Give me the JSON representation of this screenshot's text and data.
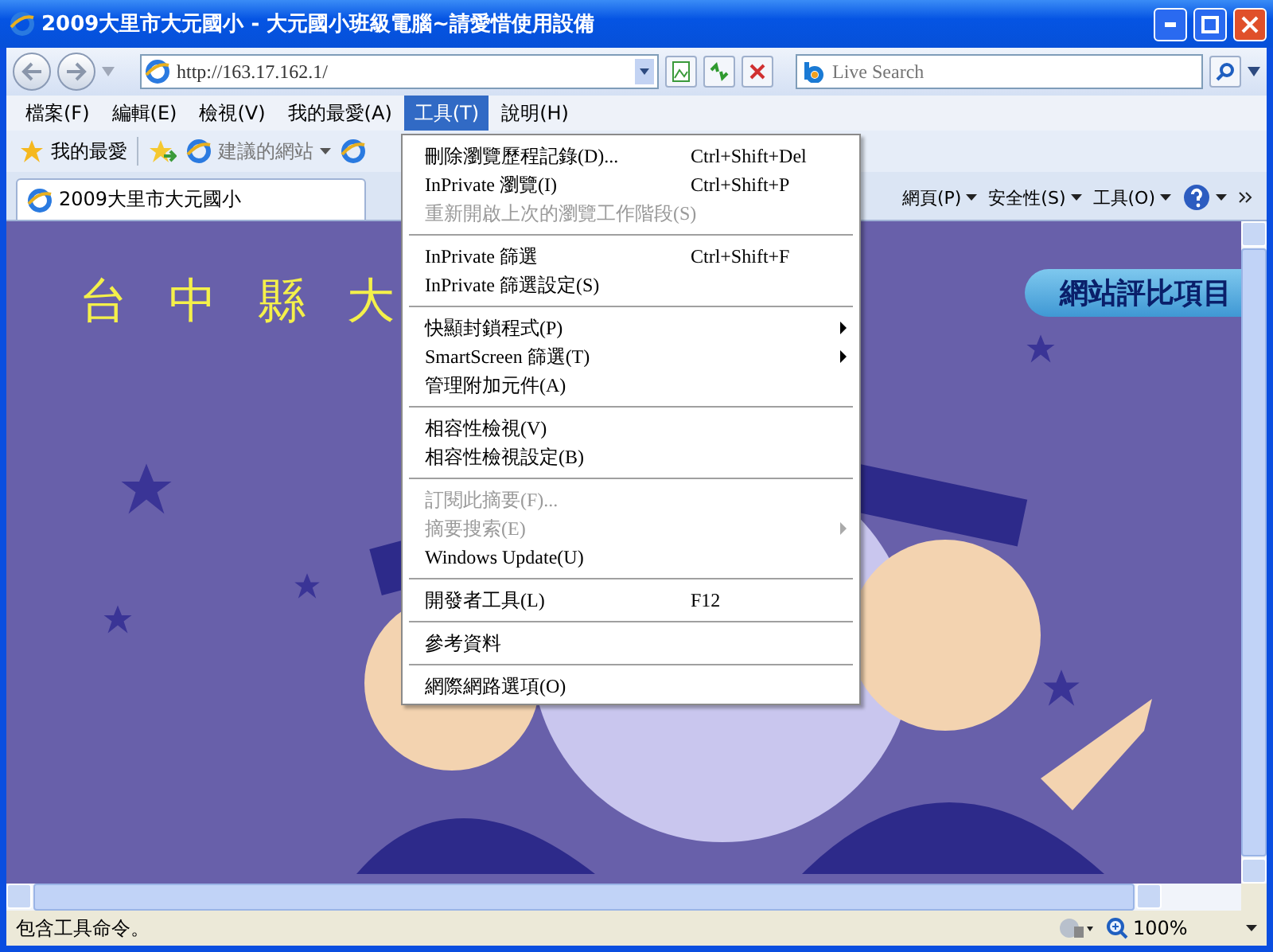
{
  "window": {
    "title": "2009大里市大元國小 - 大元國小班級電腦~請愛惜使用設備"
  },
  "address_bar": {
    "url": "http://163.17.162.1/"
  },
  "search": {
    "placeholder": "Live Search"
  },
  "menu_bar": [
    {
      "label": "檔案(F)",
      "selected": false
    },
    {
      "label": "編輯(E)",
      "selected": false
    },
    {
      "label": "檢視(V)",
      "selected": false
    },
    {
      "label": "我的最愛(A)",
      "selected": false
    },
    {
      "label": "工具(T)",
      "selected": true
    },
    {
      "label": "說明(H)",
      "selected": false
    }
  ],
  "favorites_bar": {
    "label": "我的最愛",
    "items": [
      {
        "label": "建議的網站"
      }
    ]
  },
  "tabs": [
    {
      "label": "2009大里市大元國小",
      "selected": true
    }
  ],
  "command_bar": [
    {
      "label": "網頁(P)"
    },
    {
      "label": "安全性(S)"
    },
    {
      "label": "工具(O)"
    }
  ],
  "page": {
    "heading": "台中縣大",
    "link_button": "網站評比項目"
  },
  "tools_menu": {
    "groups": [
      {
        "items": [
          {
            "label": "刪除瀏覽歷程記錄(D)...",
            "shortcut": "Ctrl+Shift+Del",
            "disabled": false,
            "submenu": false
          },
          {
            "label": "InPrivate 瀏覽(I)",
            "shortcut": "Ctrl+Shift+P",
            "disabled": false,
            "submenu": false
          },
          {
            "label": "重新開啟上次的瀏覽工作階段(S)",
            "disabled": true,
            "submenu": false
          }
        ]
      },
      {
        "items": [
          {
            "label": "InPrivate 篩選",
            "shortcut": "Ctrl+Shift+F",
            "disabled": false,
            "submenu": false
          },
          {
            "label": "InPrivate 篩選設定(S)",
            "disabled": false,
            "submenu": false
          }
        ]
      },
      {
        "items": [
          {
            "label": "快顯封鎖程式(P)",
            "disabled": false,
            "submenu": true
          },
          {
            "label": "SmartScreen 篩選(T)",
            "disabled": false,
            "submenu": true
          },
          {
            "label": "管理附加元件(A)",
            "disabled": false,
            "submenu": false
          }
        ]
      },
      {
        "items": [
          {
            "label": "相容性檢視(V)",
            "disabled": false,
            "submenu": false
          },
          {
            "label": "相容性檢視設定(B)",
            "disabled": false,
            "submenu": false
          }
        ]
      },
      {
        "items": [
          {
            "label": "訂閱此摘要(F)...",
            "disabled": true,
            "submenu": false
          },
          {
            "label": "摘要搜索(E)",
            "disabled": true,
            "submenu": true
          },
          {
            "label": "Windows Update(U)",
            "disabled": false,
            "submenu": false
          }
        ]
      },
      {
        "items": [
          {
            "label": "開發者工具(L)",
            "shortcut": "F12",
            "disabled": false,
            "submenu": false
          }
        ]
      },
      {
        "items": [
          {
            "label": "參考資料",
            "disabled": false,
            "submenu": false
          }
        ]
      },
      {
        "items": [
          {
            "label": "網際網路選項(O)",
            "disabled": false,
            "submenu": false
          }
        ]
      }
    ]
  },
  "status_bar": {
    "text": "包含工具命令。",
    "zoom": "100%"
  }
}
